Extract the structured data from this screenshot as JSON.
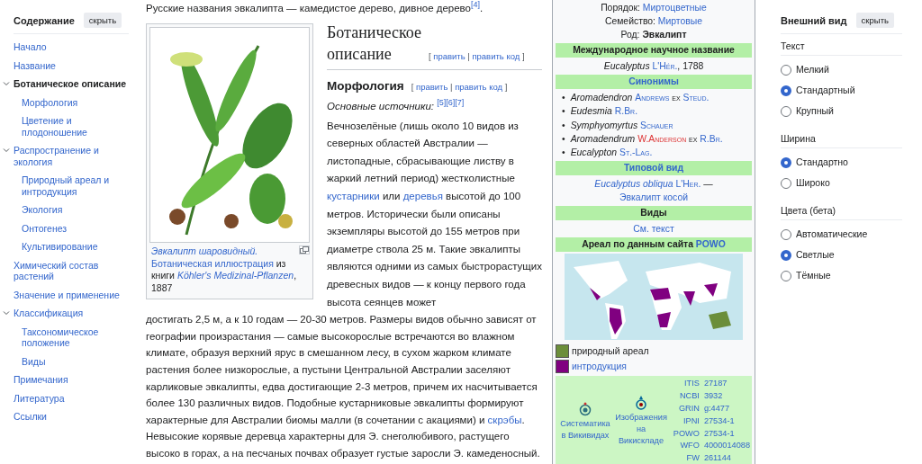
{
  "toc": {
    "title": "Содержание",
    "hide_button": "скрыть",
    "items": [
      {
        "label": "Начало",
        "selected": false
      },
      {
        "label": "Название",
        "selected": false
      },
      {
        "label": "Ботаническое описание",
        "selected": true,
        "expanded": true,
        "children": [
          {
            "label": "Морфология",
            "selected": false
          },
          {
            "label": "Цветение и плодоношение",
            "selected": false
          }
        ]
      },
      {
        "label": "Распространение и экология",
        "selected": false,
        "expanded": true,
        "children": [
          {
            "label": "Природный ареал и интродукция",
            "selected": false
          },
          {
            "label": "Экология",
            "selected": false
          },
          {
            "label": "Онтогенез",
            "selected": false
          },
          {
            "label": "Культивирование",
            "selected": false
          }
        ]
      },
      {
        "label": "Химический состав растений",
        "selected": false
      },
      {
        "label": "Значение и применение",
        "selected": false
      },
      {
        "label": "Классификация",
        "selected": false,
        "expanded": true,
        "children": [
          {
            "label": "Таксономическое положение",
            "selected": false
          },
          {
            "label": "Виды",
            "selected": false
          }
        ]
      },
      {
        "label": "Примечания",
        "selected": false
      },
      {
        "label": "Литература",
        "selected": false
      },
      {
        "label": "Ссылки",
        "selected": false
      }
    ]
  },
  "article": {
    "intro": {
      "text": "Русские названия эвкалипта — камедистое дерево, дивное дерево",
      "ref": "[4]",
      "end": "."
    },
    "figure": {
      "caption": [
        {
          "text": "Эвкалипт шаровидный.",
          "link": true,
          "italic": true
        },
        {
          "text": "Ботаническая иллюстрация",
          "link": true
        },
        {
          "text": " из книги "
        },
        {
          "text": "Köhler's Medizinal-Pflanzen",
          "link": true,
          "italic": true
        },
        {
          "text": ", 1887"
        }
      ]
    },
    "heading": {
      "title": "Ботаническое описание",
      "edit": {
        "open": "[",
        "sep": "|",
        "close": "]",
        "links": [
          "править",
          "править код"
        ]
      }
    },
    "subheading": {
      "title": "Морфология",
      "edit": {
        "open": "[",
        "sep": "|",
        "close": "]",
        "links": [
          "править",
          "править код"
        ]
      }
    },
    "sources": {
      "label": "Основные источники:",
      "refs": [
        "[5]",
        "[6]",
        "[7]"
      ]
    },
    "paragraph_beside_figure": [
      {
        "text": "Вечнозелёные (лишь около 10 видов из северных областей Австралии — листопадные, сбрасывающие листву в жаркий летний период) жестколистные "
      },
      {
        "text": "кустарники",
        "link": true
      },
      {
        "text": " или "
      },
      {
        "text": "деревья",
        "link": true
      },
      {
        "text": " высотой до 100 метров. Исторически были описаны экземпляры высотой до 155 метров при диаметре ствола 25 м. Такие эвкалипты являются одними из самых быстрорастущих древесных видов — к концу первого года высота сеянцев может"
      }
    ],
    "paragraph_below_figure": [
      {
        "text": "достигать 2,5 м, а к 10 годам — 20-30 метров. Размеры видов обычно зависят от географии произрастания — самые высокорослые встречаются во влажном климате, образуя верхний ярус в смешанном лесу, в сухом жарком климате растения более низкорослые, а пустыни Центральной Австралии заселяют карликовые эвкалипты, едва достигающие 2-3 метров, причем их насчитывается более 130 различных видов. Подобные кустарниковые эвкалипты формируют характерные для Австралии биомы малли (в сочетании с акациями) и "
      },
      {
        "text": "скрэбы",
        "link": true
      },
      {
        "text": ". Невысокие корявые деревца характерны для Э. снеголюбивого, растущего высоко в горах, а на песчаных почвах образует густые заросли Э. камеденосный."
      }
    ]
  },
  "infobox": {
    "taxonomy": [
      {
        "rank": "Порядок:",
        "value": "Миртоцветные",
        "link": true
      },
      {
        "rank": "Семейство:",
        "value": "Миртовые",
        "link": true
      },
      {
        "rank": "Род:",
        "value": "Эвкалипт",
        "link": false
      }
    ],
    "name_header": "Международное научное название",
    "name": [
      {
        "text": "Eucalyptus",
        "kind": "genus"
      },
      {
        "text": "L'Hér.",
        "kind": "author"
      },
      {
        "text": ", 1788",
        "kind": "plain"
      }
    ],
    "synonyms_header": "Синонимы",
    "synonyms": [
      {
        "bullet": "•",
        "parts": [
          {
            "text": "Aromadendron",
            "kind": "genus"
          },
          {
            "text": "Andrews",
            "kind": "author"
          },
          {
            "text": "ex",
            "kind": "plain-sc"
          },
          {
            "text": "Steud.",
            "kind": "author"
          }
        ]
      },
      {
        "bullet": "•",
        "parts": [
          {
            "text": "Eudesmia",
            "kind": "genus"
          },
          {
            "text": "R.Br.",
            "kind": "author"
          }
        ]
      },
      {
        "bullet": "•",
        "parts": [
          {
            "text": "Symphyomyrtus",
            "kind": "genus"
          },
          {
            "text": "Schauer",
            "kind": "author"
          }
        ]
      },
      {
        "bullet": "•",
        "parts": [
          {
            "text": "Aromadendrum",
            "kind": "genus"
          },
          {
            "text": "W.Anderson",
            "kind": "redlink"
          },
          {
            "text": "ex",
            "kind": "plain-sc"
          },
          {
            "text": "R.Br.",
            "kind": "author"
          }
        ]
      },
      {
        "bullet": "•",
        "parts": [
          {
            "text": "Eucalypton",
            "kind": "genus"
          },
          {
            "text": "St.-Lag.",
            "kind": "author"
          }
        ]
      }
    ],
    "type_header": "Типовой вид",
    "type_species": [
      {
        "text": "Eucalyptus obliqua",
        "kind": "genus-link"
      },
      {
        "text": "L'Her.",
        "kind": "author"
      },
      {
        "text": "—",
        "kind": "plain"
      },
      {
        "text": "Эвкалипт косой",
        "kind": "link"
      }
    ],
    "species_header": "Виды",
    "species_link": "См. текст",
    "range_header": {
      "text": "Ареал по данным сайта ",
      "link": "POWO"
    },
    "legend": [
      {
        "label": "природный ареал",
        "color": "#6b8e3a",
        "link": false
      },
      {
        "label": "интродукция",
        "color": "#800080",
        "link": true
      }
    ],
    "projects": [
      {
        "label": "Систематика в Викивидах",
        "kind": "species"
      },
      {
        "label": "Изображения на Викискладе",
        "kind": "commons"
      }
    ],
    "ids": [
      {
        "db": "ITIS",
        "id": "27187"
      },
      {
        "db": "NCBI",
        "id": "3932"
      },
      {
        "db": "GRIN",
        "id": "g:4477"
      },
      {
        "db": "IPNI",
        "id": "27534-1"
      },
      {
        "db": "POWO",
        "id": "27534-1"
      },
      {
        "db": "WFO",
        "id": "4000014088"
      },
      {
        "db": "FW",
        "id": "261144"
      }
    ]
  },
  "appearance": {
    "title": "Внешний вид",
    "hide_button": "скрыть",
    "groups": [
      {
        "label": "Текст",
        "options": [
          {
            "label": "Мелкий",
            "selected": false
          },
          {
            "label": "Стандартный",
            "selected": true
          },
          {
            "label": "Крупный",
            "selected": false
          }
        ]
      },
      {
        "label": "Ширина",
        "options": [
          {
            "label": "Стандартно",
            "selected": true
          },
          {
            "label": "Широко",
            "selected": false
          }
        ]
      },
      {
        "label": "Цвета (бета)",
        "options": [
          {
            "label": "Автоматические",
            "selected": false
          },
          {
            "label": "Светлые",
            "selected": true
          },
          {
            "label": "Тёмные",
            "selected": false
          }
        ]
      }
    ]
  }
}
